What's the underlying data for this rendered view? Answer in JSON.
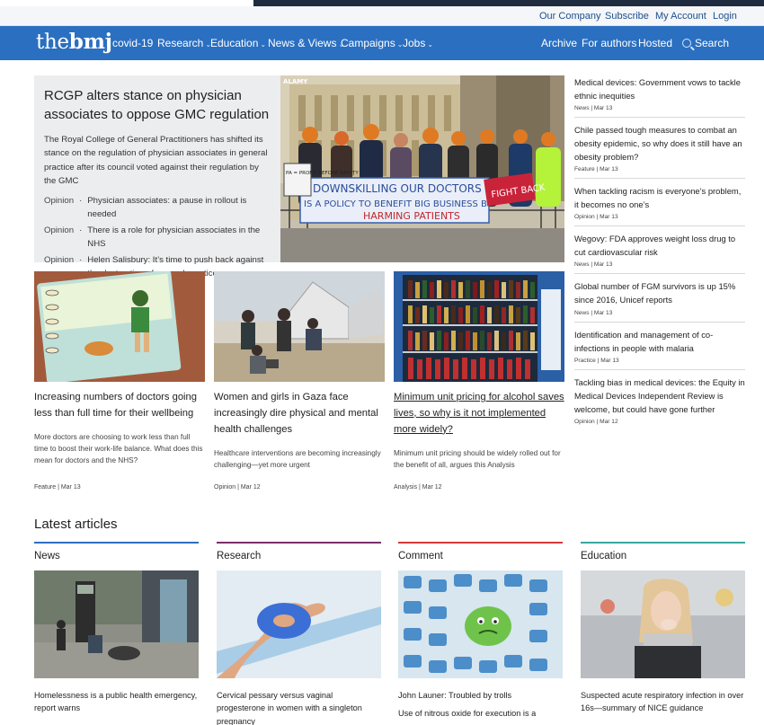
{
  "colors": {
    "brand": "#2b6fc0",
    "dark_band": "#1f2b3e",
    "news_bar": "#2b6fc0",
    "research_bar": "#7a2f6b",
    "comment_bar": "#d23a3a",
    "education_bar": "#3aa6a0"
  },
  "utility_nav": [
    "Our Company",
    "Subscribe",
    "My Account",
    "Login"
  ],
  "logo": {
    "pre": "the",
    "bold": "bmj"
  },
  "main_nav": [
    {
      "label": "covid-19",
      "dropdown": false
    },
    {
      "label": "Research",
      "dropdown": true
    },
    {
      "label": "Education",
      "dropdown": true
    },
    {
      "label": "News & Views",
      "dropdown": true
    },
    {
      "label": "Campaigns",
      "dropdown": true
    },
    {
      "label": "Jobs",
      "dropdown": true
    }
  ],
  "right_nav": {
    "archive": "Archive",
    "authors": "For authors",
    "hosted": "Hosted",
    "search": "Search",
    "search_icon": "search-icon"
  },
  "lead": {
    "title": "RCGP alters stance on physician associates to oppose GMC regulation",
    "summary": "The Royal College of General Practitioners has shifted its stance on the regulation of physician associates in general practice after its council voted against their regulation by the GMC",
    "related": [
      {
        "type": "Opinion",
        "title": "Physician associates: a pause in rollout is needed"
      },
      {
        "type": "Opinion",
        "title": "There is a role for physician associates in the NHS"
      },
      {
        "type": "Opinion",
        "title": "Helen Salisbury: It’s time to push back against the destruction of general practice"
      }
    ],
    "hero": {
      "credit": "ALAMY",
      "banner1": "DOWNSKILLING OUR DOCTORS",
      "banner2": "IS A POLICY TO BENEFIT BIG BUSINESS BY",
      "banner3": "HARMING PATIENTS",
      "sign1": "FIGHT BACK",
      "sign2": "PA = PROFIT BEFORE SAFETY"
    }
  },
  "cards": [
    {
      "title": "Increasing numbers of doctors going less than full time for their wellbeing",
      "summary": "More doctors are choosing to work less than full time to boost their work-life balance. What does this mean for doctors and the NHS?",
      "meta": "Feature | Mar 13",
      "linked": false
    },
    {
      "title": "Women and girls in Gaza face increasingly dire physical and mental health challenges",
      "summary": "Healthcare interventions are becoming increasingly challenging—yet more urgent",
      "meta": "Opinion | Mar 12",
      "linked": false
    },
    {
      "title": "Minimum unit pricing for alcohol saves lives, so why is it not implemented more widely?",
      "summary": "Minimum unit pricing should be widely rolled out for the benefit of all, argues this Analysis",
      "meta": "Analysis | Mar 12",
      "linked": true
    }
  ],
  "sidebar": [
    {
      "title": "Medical devices: Government vows to tackle ethnic inequities",
      "meta": "News | Mar 13"
    },
    {
      "title": "Chile passed tough measures to combat an obesity epidemic, so why does it still have an obesity problem?",
      "meta": "Feature | Mar 13"
    },
    {
      "title": "When tackling racism is everyone’s problem, it becomes no one’s",
      "meta": "Opinion | Mar 13"
    },
    {
      "title": "Wegovy: FDA approves weight loss drug to cut cardiovascular risk",
      "meta": "News | Mar 13"
    },
    {
      "title": "Global number of FGM survivors is up 15% since 2016, Unicef reports",
      "meta": "News | Mar 13"
    },
    {
      "title": "Identification and management of co-infections in people with malaria",
      "meta": "Practice | Mar 13"
    },
    {
      "title": "Tackling bias in medical devices: the Equity in Medical Devices Independent Review is welcome, but could have gone further",
      "meta": "Opinion | Mar 12"
    }
  ],
  "latest": {
    "heading": "Latest articles",
    "columns": [
      {
        "name": "News",
        "articles": [
          "Homelessness is a public health emergency, report warns"
        ]
      },
      {
        "name": "Research",
        "articles": [
          "Cervical pessary versus vaginal progesterone in women with a singleton pregnancy"
        ]
      },
      {
        "name": "Comment",
        "articles": [
          "John Launer: Troubled by trolls",
          "Use of nitrous oxide for execution is a"
        ]
      },
      {
        "name": "Education",
        "articles": [
          "Suspected acute respiratory infection in over 16s—summary of NICE guidance"
        ]
      }
    ]
  }
}
